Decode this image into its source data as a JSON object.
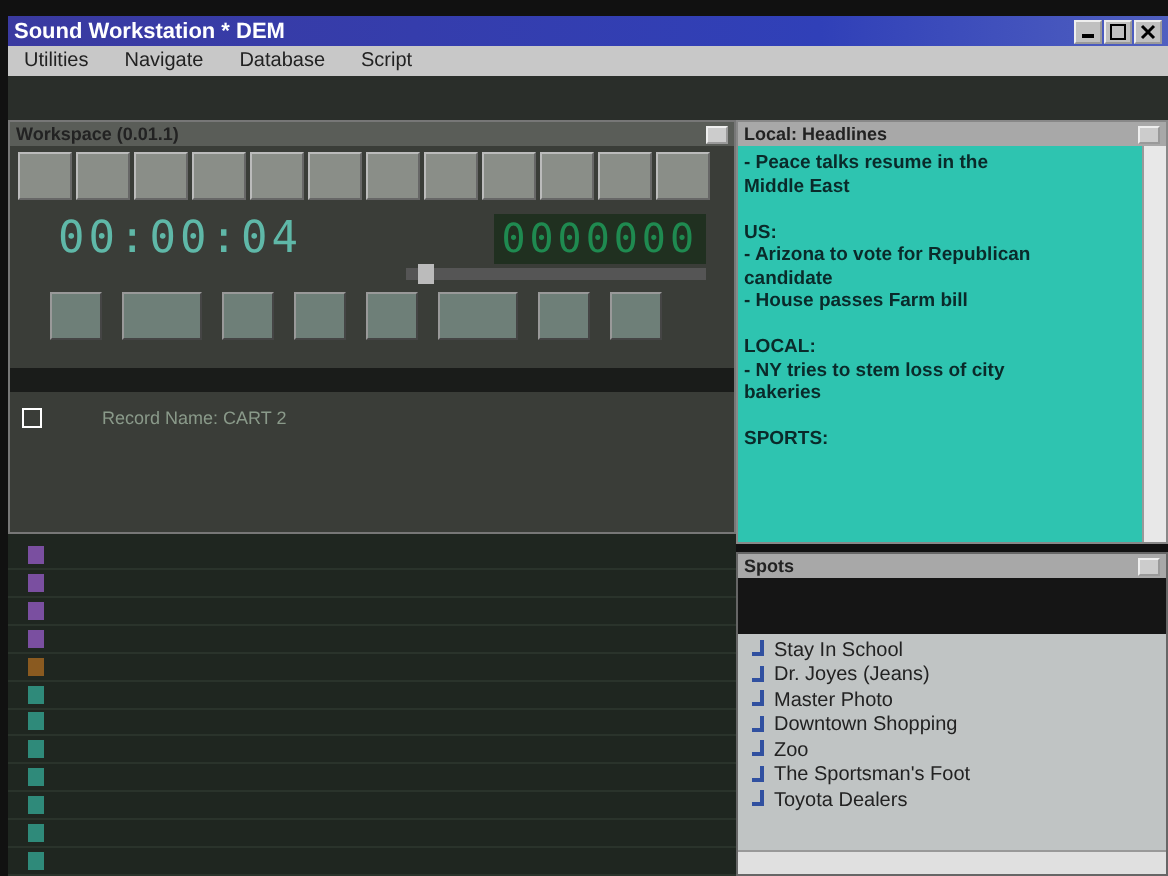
{
  "window": {
    "title": "Sound Workstation * DEM"
  },
  "menu": [
    {
      "label": "Utilities"
    },
    {
      "label": "Navigate"
    },
    {
      "label": "Database"
    },
    {
      "label": "Script"
    }
  ],
  "workspace": {
    "title": "Workspace (0.01.1)",
    "timer": "00:00:04",
    "counter": "0000000",
    "scrub": {
      "level": 0.04
    },
    "record_label": "Record Name: CART 2"
  },
  "log_rows": [
    {
      "color": "#7a4fa0"
    },
    {
      "color": "#7a4fa0"
    },
    {
      "color": "#7a4fa0"
    },
    {
      "color": "#7a4fa0"
    },
    {
      "color": "#8a5a20"
    },
    {
      "color": "#2f8a7a"
    },
    {
      "color": "#2f8a7a"
    },
    {
      "color": "#2f8a7a"
    },
    {
      "color": "#2f8a7a"
    },
    {
      "color": "#2f8a7a"
    },
    {
      "color": "#2f8a7a"
    },
    {
      "color": "#2f8a7a"
    }
  ],
  "headlines": {
    "title": "Local: Headlines",
    "paragraphs": [
      {
        "lines": [
          "- Peace talks resume in the",
          "Middle East"
        ]
      },
      {
        "lines": [
          "US:",
          "- Arizona to vote for Republican",
          "candidate",
          "- House passes Farm bill"
        ]
      },
      {
        "lines": [
          "LOCAL:",
          "- NY tries to stem loss of city",
          "bakeries"
        ]
      },
      {
        "lines": [
          "SPORTS:"
        ]
      }
    ]
  },
  "spots": {
    "title": "Spots",
    "items": [
      "Stay In School",
      "Dr. Joyes (Jeans)",
      "Master Photo",
      "Downtown Shopping",
      "Zoo",
      "The Sportsman's Foot",
      "Toyota Dealers"
    ]
  }
}
